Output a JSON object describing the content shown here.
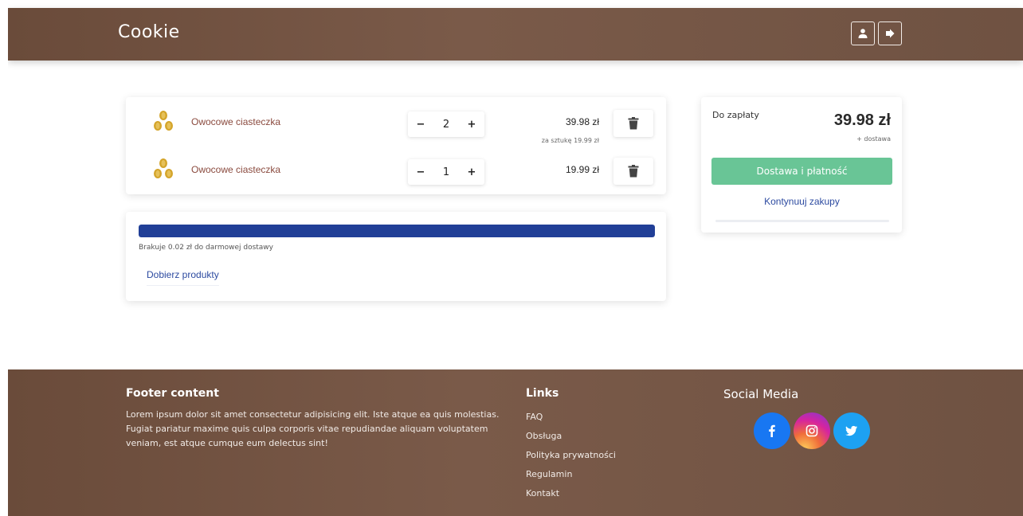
{
  "header": {
    "brand": "Cookie",
    "icons": [
      "user-icon",
      "logout-icon"
    ]
  },
  "cart": {
    "items": [
      {
        "name": "Owocowe ciasteczka",
        "quantity": "2",
        "price": "39.98 zł",
        "unit_note": "za sztukę 19.99 zł",
        "icon": "coins-icon"
      },
      {
        "name": "Owocowe ciasteczka",
        "quantity": "1",
        "price": "19.99 zł",
        "unit_note": "",
        "icon": "coins-icon"
      }
    ],
    "minus_label": "−",
    "plus_label": "+",
    "trash_icon": "trash-icon"
  },
  "delivery": {
    "progress_fraction": 1.0,
    "note": "Brakuje 0.02 zł do darmowej dostawy",
    "add_products_label": "Dobierz produkty",
    "bar_color": "#213f97"
  },
  "summary": {
    "to_pay_label": "Do zapłaty",
    "total": "39.98 zł",
    "delivery_note": "+ dostawa",
    "checkout_label": "Dostawa i płatność",
    "continue_label": "Kontynuuj zakupy",
    "checkout_color": "#69c596"
  },
  "footer": {
    "content_title": "Footer content",
    "content_text": "Lorem ipsum dolor sit amet consectetur adipisicing elit. Iste atque ea quis molestias. Fugiat pariatur maxime quis culpa corporis vitae repudiandae aliquam voluptatem veniam, est atque cumque eum delectus sint!",
    "links_title": "Links",
    "links": [
      "FAQ",
      "Obsługa",
      "Polityka prywatności",
      "Regulamin",
      "Kontakt"
    ],
    "social_title": "Social Media",
    "social_icons": [
      "facebook-icon",
      "instagram-icon",
      "twitter-icon"
    ]
  },
  "colors": {
    "header_bg": "#6f5242",
    "link_blue": "#2c4aa0",
    "item_name": "#8a4a3e"
  }
}
